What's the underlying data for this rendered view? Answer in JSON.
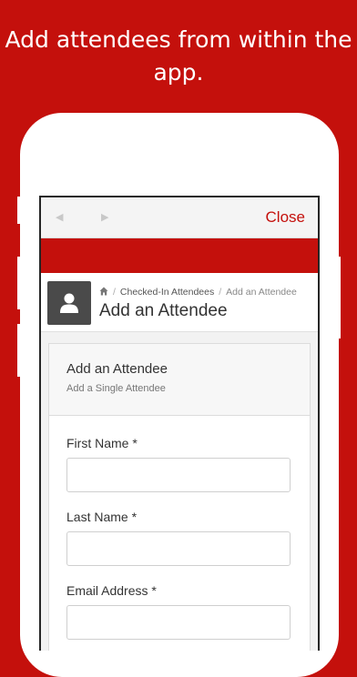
{
  "promo": {
    "line1": "Add attendees from within the",
    "line2": "app."
  },
  "browser": {
    "back_icon": "back-arrow-icon",
    "forward_icon": "forward-arrow-icon",
    "close_label": "Close"
  },
  "header": {
    "avatar_icon": "user-icon",
    "breadcrumb": {
      "home_icon": "home-icon",
      "items": [
        "Checked-In Attendees",
        "Add an Attendee"
      ]
    },
    "title": "Add an Attendee"
  },
  "form": {
    "title": "Add an Attendee",
    "subtitle": "Add a Single Attendee",
    "fields": [
      {
        "label": "First Name *",
        "value": ""
      },
      {
        "label": "Last Name *",
        "value": ""
      },
      {
        "label": "Email Address *",
        "value": ""
      }
    ]
  },
  "colors": {
    "brand": "#c4100c",
    "avatar_bg": "#4a4a4a"
  }
}
